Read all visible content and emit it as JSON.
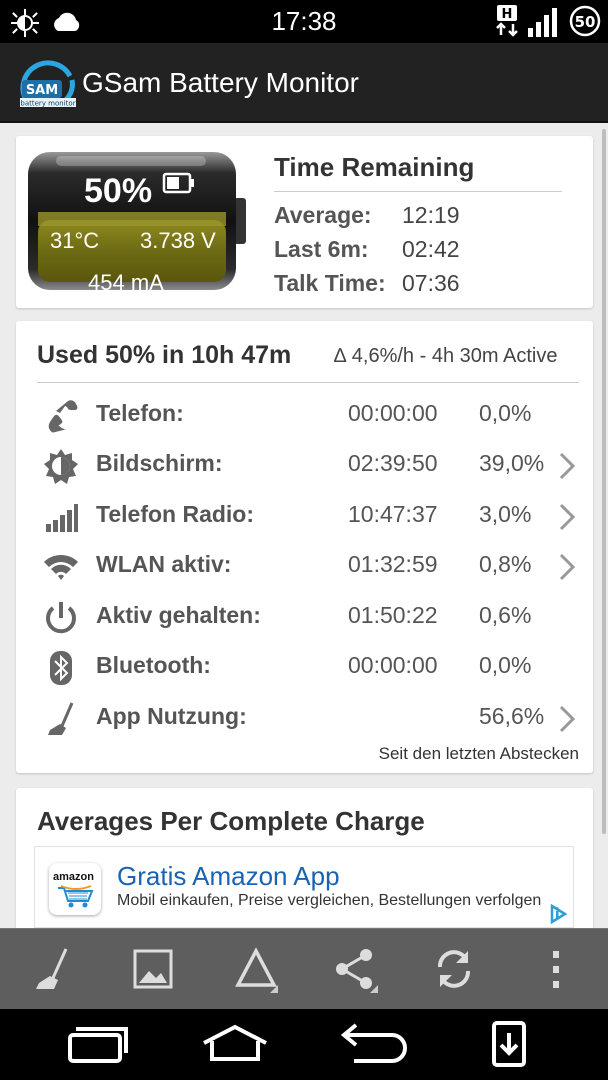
{
  "status_bar": {
    "time": "17:38",
    "network_type": "H",
    "battery_level": "50",
    "icons": [
      "brightness-auto-icon",
      "weather-cloud-icon",
      "data-arrows-icon",
      "signal-strength-icon",
      "battery-circle-icon"
    ]
  },
  "app_bar": {
    "title": "GSam Battery Monitor",
    "logo_text": "SAM",
    "logo_subtext": "battery monitor"
  },
  "battery": {
    "percent": "50%",
    "temperature": "31°C",
    "voltage": "3.738 V",
    "current": "454 mA",
    "charge_level": 0.5
  },
  "time_remaining": {
    "title": "Time Remaining",
    "rows": [
      {
        "label": "Average:",
        "value": "12:19"
      },
      {
        "label": "Last 6m:",
        "value": "02:42"
      },
      {
        "label": "Talk Time:",
        "value": "07:36"
      }
    ]
  },
  "usage": {
    "header": "Used 50% in 10h 47m",
    "subheader": "∆ 4,6%/h - 4h 30m Active",
    "rows": [
      {
        "icon": "phone-icon",
        "label": "Telefon:",
        "duration": "00:00:00",
        "percent": "0,0%",
        "has_detail": false
      },
      {
        "icon": "screen-brightness-icon",
        "label": "Bildschirm:",
        "duration": "02:39:50",
        "percent": "39,0%",
        "has_detail": true
      },
      {
        "icon": "signal-bars-icon",
        "label": "Telefon Radio:",
        "duration": "10:47:37",
        "percent": "3,0%",
        "has_detail": true
      },
      {
        "icon": "wifi-icon",
        "label": "WLAN aktiv:",
        "duration": "01:32:59",
        "percent": "0,8%",
        "has_detail": true
      },
      {
        "icon": "power-icon",
        "label": "Aktiv gehalten:",
        "duration": "01:50:22",
        "percent": "0,6%",
        "has_detail": false
      },
      {
        "icon": "bluetooth-icon",
        "label": "Bluetooth:",
        "duration": "00:00:00",
        "percent": "0,0%",
        "has_detail": false
      },
      {
        "icon": "broom-icon",
        "label": "App Nutzung:",
        "duration": "",
        "percent": "56,6%",
        "has_detail": true
      }
    ],
    "footer": "Seit den letzten Abstecken"
  },
  "averages": {
    "title": "Averages Per Complete Charge"
  },
  "ad": {
    "brand": "amazon",
    "title": "Gratis Amazon App",
    "subtitle": "Mobil einkaufen, Preise vergleichen, Bestellungen verfolgen"
  },
  "toolbar": {
    "buttons": [
      "broom-icon",
      "image-icon",
      "delta-icon",
      "share-icon",
      "refresh-icon",
      "overflow-menu-icon"
    ]
  },
  "nav": {
    "buttons": [
      "recent-apps-icon",
      "home-icon",
      "back-icon",
      "download-icon"
    ]
  }
}
